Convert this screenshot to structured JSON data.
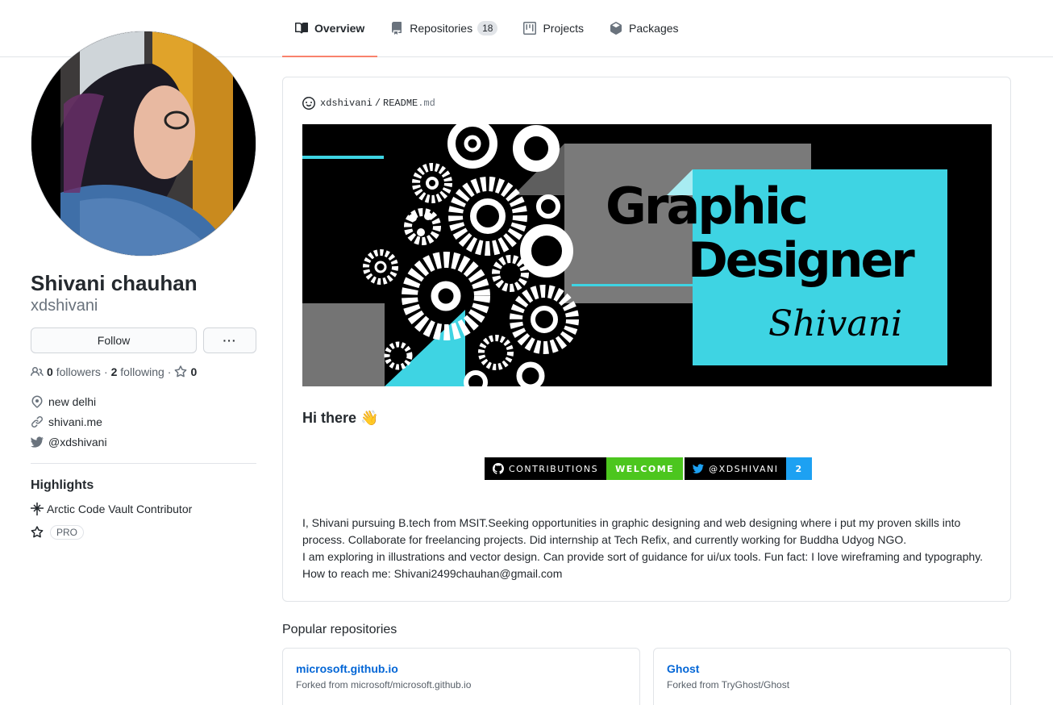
{
  "nav": {
    "tabs": [
      {
        "label": "Overview",
        "icon": "book-icon"
      },
      {
        "label": "Repositories",
        "icon": "repo-icon",
        "count": "18"
      },
      {
        "label": "Projects",
        "icon": "project-icon"
      },
      {
        "label": "Packages",
        "icon": "package-icon"
      }
    ]
  },
  "profile": {
    "fullname": "Shivani chauhan",
    "username": "xdshivani",
    "follow_label": "Follow",
    "more_label": "···",
    "followers_count": "0",
    "followers_label": "followers",
    "following_count": "2",
    "following_label": "following",
    "stars_count": "0",
    "location": "new delhi",
    "website": "shivani.me",
    "twitter": "@xdshivani"
  },
  "highlights": {
    "title": "Highlights",
    "items": [
      "Arctic Code Vault Contributor"
    ],
    "pro_label": "PRO"
  },
  "readme": {
    "owner": "xdshivani",
    "separator": "/",
    "file": "README",
    "ext": ".md",
    "banner": {
      "line1": "Graphic",
      "line2": "Designer",
      "signature": "Shivani"
    },
    "greeting": "Hi there 👋",
    "badges": [
      {
        "left": "CONTRIBUTIONS",
        "right": "WELCOME",
        "color": "#4cc61e",
        "icon": "github-icon"
      },
      {
        "left": "@XDSHIVANI",
        "right": "2",
        "color": "#1da1f2",
        "icon": "twitter-icon"
      }
    ],
    "bio_lines": [
      "I, Shivani pursuing B.tech from MSIT.Seeking opportunities in graphic designing and web designing where i put my proven skills into process. Collaborate for freelancing projects. Did internship at Tech Refix, and currently working for Buddha Udyog NGO.",
      "I am exploring in illustrations and vector design. Can provide sort of guidance for ui/ux tools. Fun fact: I love wireframing and typography.",
      "How to reach me: Shivani2499chauhan@gmail.com"
    ]
  },
  "popular": {
    "title": "Popular repositories",
    "repos": [
      {
        "name": "microsoft.github.io",
        "fork": "Forked from microsoft/microsoft.github.io"
      },
      {
        "name": "Ghost",
        "fork": "Forked from TryGhost/Ghost"
      }
    ]
  },
  "colors": {
    "accent_tab": "#f9826c",
    "link": "#0366d6",
    "banner_cyan": "#3ed4e3",
    "banner_gray": "#7a7a7a"
  }
}
